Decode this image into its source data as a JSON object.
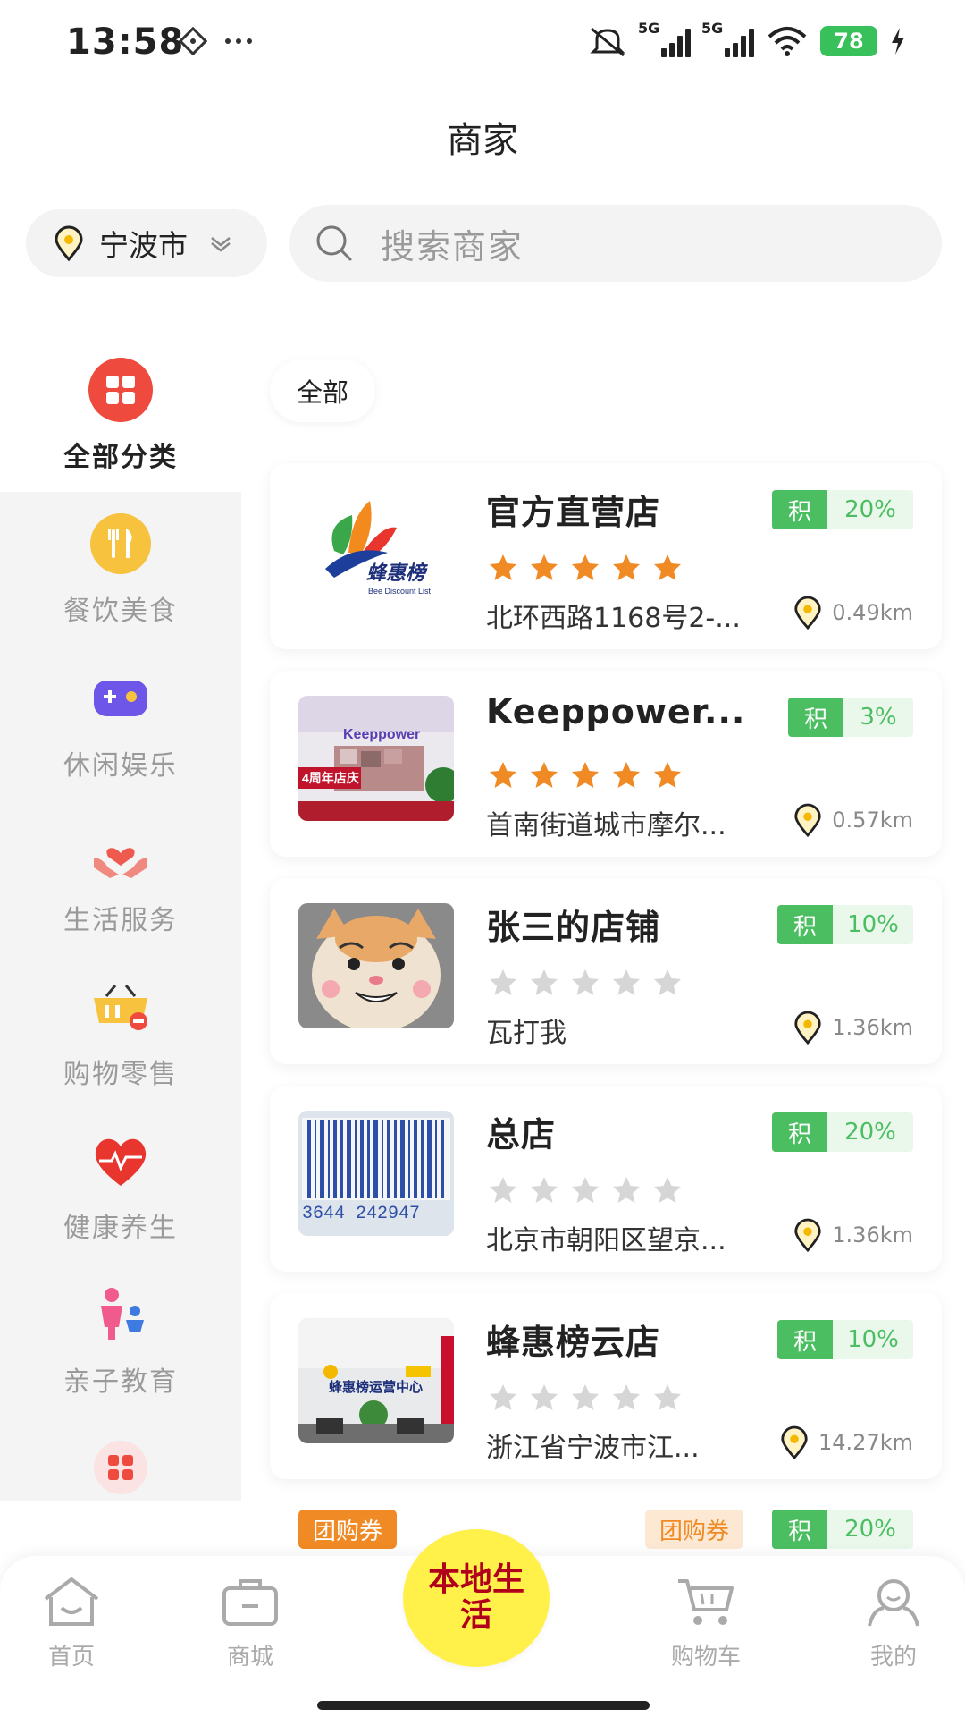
{
  "status_bar": {
    "time": "13:58",
    "battery": "78",
    "signal_label_1": "5G",
    "signal_label_2": "5G"
  },
  "header": {
    "title": "商家"
  },
  "location": {
    "city": "宁波市"
  },
  "search": {
    "placeholder": "搜索商家"
  },
  "sidebar": {
    "items": [
      {
        "label": "全部分类",
        "icon": "grid-icon",
        "active": true
      },
      {
        "label": "餐饮美食",
        "icon": "fork-knife-icon"
      },
      {
        "label": "休闲娱乐",
        "icon": "gamepad-icon"
      },
      {
        "label": "生活服务",
        "icon": "hands-heart-icon"
      },
      {
        "label": "购物零售",
        "icon": "shopping-basket-icon"
      },
      {
        "label": "健康养生",
        "icon": "heart-pulse-icon"
      },
      {
        "label": "亲子教育",
        "icon": "parent-child-icon"
      },
      {
        "label": "",
        "icon": "more-grid-icon"
      }
    ]
  },
  "filter": {
    "active_tab": "全部"
  },
  "merchants": [
    {
      "name": "官方直营店",
      "points_label": "积",
      "points": "20%",
      "rating": 5,
      "address": "北环西路1168号2-...",
      "distance": "0.49km",
      "thumb": "logo"
    },
    {
      "name": "Keeppower...",
      "points_label": "积",
      "points": "3%",
      "rating": 5,
      "address": "首南街道城市摩尔...",
      "distance": "0.57km",
      "thumb": "store"
    },
    {
      "name": "张三的店铺",
      "points_label": "积",
      "points": "10%",
      "rating": 0,
      "address": "瓦打我",
      "distance": "1.36km",
      "thumb": "cat"
    },
    {
      "name": "总店",
      "points_label": "积",
      "points": "20%",
      "rating": 0,
      "address": "北京市朝阳区望京...",
      "distance": "1.36km",
      "thumb": "barcode"
    },
    {
      "name": "蜂惠榜云店",
      "points_label": "积",
      "points": "10%",
      "rating": 0,
      "address": "浙江省宁波市江...",
      "distance": "14.27km",
      "thumb": "office"
    }
  ],
  "partial": {
    "tag1": "团购券",
    "tag2": "团购券",
    "points_label": "积",
    "points": "20%"
  },
  "bottom_nav": {
    "home": "首页",
    "mall": "商城",
    "center": "本地生活",
    "cart": "购物车",
    "mine": "我的"
  },
  "logo_text": {
    "brand": "蜂惠榜",
    "sub": "Bee Discount List",
    "store_sign": "Keeppower",
    "anniv": "4周年店庆",
    "barcode_num": "3644 242947",
    "office_sign": "蜂惠榜运营中心"
  },
  "colors": {
    "accent_green": "#4cbe62",
    "star_orange": "#f08a24",
    "star_gray": "#d6d6d6",
    "center_yellow": "#fff04a"
  }
}
